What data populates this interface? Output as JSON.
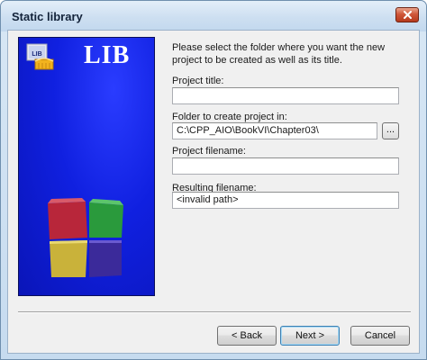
{
  "window": {
    "title": "Static library"
  },
  "banner": {
    "badge_text": "LIB",
    "logo_text": "LIB"
  },
  "form": {
    "instructions": "Please select the folder where you want the new project to be created as well as its title.",
    "project_title_label": "Project title:",
    "project_title_value": "",
    "folder_label": "Folder to create project in:",
    "folder_value": "C:\\CPP_AIO\\BookVI\\Chapter03\\",
    "browse_label": "...",
    "filename_label": "Project filename:",
    "filename_value": "",
    "resulting_label": "Resulting filename:",
    "resulting_value": "<invalid path>"
  },
  "buttons": {
    "back": "< Back",
    "next": "Next >",
    "cancel": "Cancel"
  }
}
